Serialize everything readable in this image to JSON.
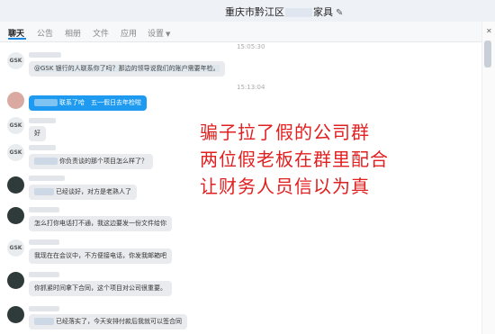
{
  "window": {
    "title_prefix": "重庆市黔江区",
    "title_suffix": "家具",
    "edit_icon": "pencil-icon"
  },
  "tabs": [
    "聊天",
    "公告",
    "相册",
    "文件",
    "应用",
    "设置"
  ],
  "timestamps": [
    "15:05:30",
    "15:13:04"
  ],
  "messages": [
    {
      "text": "@GSK 银行的人联系你了吗？那边的领导说我们的账户需要年检。"
    },
    {
      "text": "联系了哈　五一假日去年检啦"
    },
    {
      "text": "好"
    },
    {
      "text": "你负责谈的那个项目怎么样了？"
    },
    {
      "text": "已经谈好，对方是老熟人了"
    },
    {
      "text": "怎么打你电话打不通，我这边要发一份文件给你"
    },
    {
      "text": "我现在在会议中，不方便接电话，你发我邮箱吧"
    },
    {
      "text": "你抓紧时间拿下合同，这个项目对公司很重要。"
    },
    {
      "text": "已经落实了，今天安排付款后我就可以签合同"
    }
  ],
  "overlay": {
    "lines": [
      "骗子拉了假的公司群",
      "两位假老板在群里配合",
      "让财务人员信以为真"
    ],
    "color": "#e02020"
  },
  "colors": {
    "accent": "#1e88e5",
    "bubble": "#e9ebee",
    "my_bubble": "#1e9bf0"
  }
}
